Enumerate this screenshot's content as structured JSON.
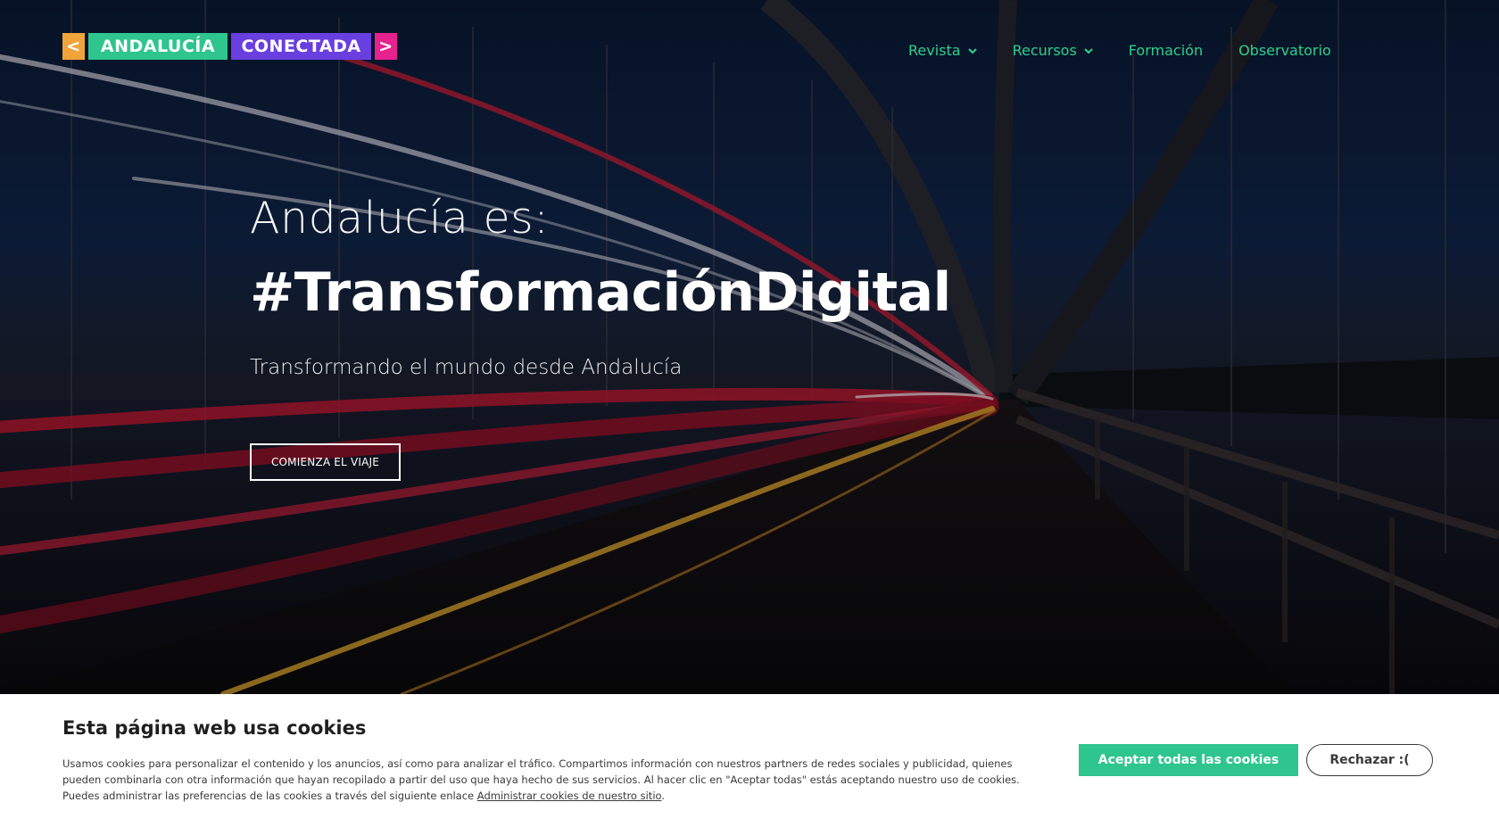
{
  "logo": {
    "left_bracket": "<",
    "word1": "ANDALUCÍA",
    "word2": "CONECTADA",
    "right_bracket": ">",
    "colors": {
      "bracket_left": "#f0a43a",
      "word1": "#2ec58e",
      "word2": "#6a3fe0",
      "bracket_right": "#e6228f"
    }
  },
  "nav": {
    "items": [
      {
        "label": "Revista",
        "has_dropdown": true,
        "icon": "chevron-down-icon"
      },
      {
        "label": "Recursos",
        "has_dropdown": true,
        "icon": "chevron-down-icon"
      },
      {
        "label": "Formación",
        "has_dropdown": false
      },
      {
        "label": "Observatorio",
        "has_dropdown": false
      }
    ],
    "color": "#2ed08e"
  },
  "hero": {
    "pre_title": "Andalucía es:",
    "title": "#TransformaciónDigital",
    "subtitle": "Transformando el mundo desde Andalucía",
    "cta_label": "COMIENZA EL VIAJE"
  },
  "cookie_banner": {
    "title": "Esta página web usa cookies",
    "text": "Usamos cookies para personalizar el contenido y los anuncios, así como para analizar el tráfico. Compartimos información con nuestros partners de redes sociales y publicidad, quienes pueden combinarla con otra información que hayan recopilado a partir del uso que haya hecho de sus servicios. Al hacer clic en \"Aceptar todas\" estás aceptando nuestro uso de cookies. Puedes administrar las preferencias de las cookies a través del siguiente enlace ",
    "link_label": "Administrar cookies de nuestro sitio",
    "text_end": ".",
    "accept_label": "Aceptar todas las cookies",
    "reject_label": "Rechazar :(",
    "accent_color": "#2ec58e"
  }
}
